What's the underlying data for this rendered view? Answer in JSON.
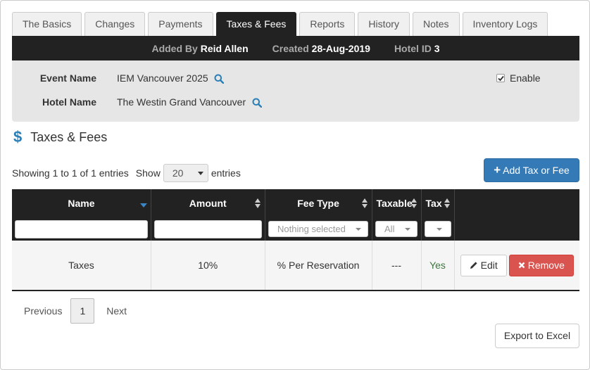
{
  "tabs": [
    {
      "label": "The Basics",
      "active": false
    },
    {
      "label": "Changes",
      "active": false
    },
    {
      "label": "Payments",
      "active": false
    },
    {
      "label": "Taxes & Fees",
      "active": true
    },
    {
      "label": "Reports",
      "active": false
    },
    {
      "label": "History",
      "active": false
    },
    {
      "label": "Notes",
      "active": false
    },
    {
      "label": "Inventory Logs",
      "active": false
    }
  ],
  "info": {
    "added_by_label": "Added By",
    "added_by_value": "Reid Allen",
    "created_label": "Created",
    "created_value": "28-Aug-2019",
    "hotel_id_label": "Hotel ID",
    "hotel_id_value": "3"
  },
  "event": {
    "event_name_label": "Event Name",
    "event_name_value": "IEM Vancouver 2025",
    "hotel_name_label": "Hotel Name",
    "hotel_name_value": "The Westin Grand Vancouver",
    "enable_label": "Enable",
    "enable_checked": true
  },
  "section": {
    "icon": "dollar-icon",
    "title": "Taxes & Fees"
  },
  "listing": {
    "showing_text": "Showing 1 to 1 of 1 entries",
    "show_label": "Show",
    "page_length": "20",
    "entries_label": "entries"
  },
  "add_button_label": "Add Tax or Fee",
  "table": {
    "columns": [
      "Name",
      "Amount",
      "Fee Type",
      "Taxable",
      "Tax",
      ""
    ],
    "filters": {
      "fee_type": "Nothing selected",
      "taxable": "All",
      "tax": ""
    },
    "rows": [
      {
        "name": "Taxes",
        "amount": "10%",
        "fee_type": "% Per Reservation",
        "taxable": "---",
        "tax": "Yes",
        "edit_label": "Edit",
        "remove_label": "Remove"
      }
    ]
  },
  "pagination": {
    "previous": "Previous",
    "current": "1",
    "next": "Next"
  },
  "export_label": "Export to Excel",
  "colors": {
    "primary": "#337ab7",
    "danger": "#d9534f",
    "header": "#222222",
    "success_text": "#3c763d"
  }
}
